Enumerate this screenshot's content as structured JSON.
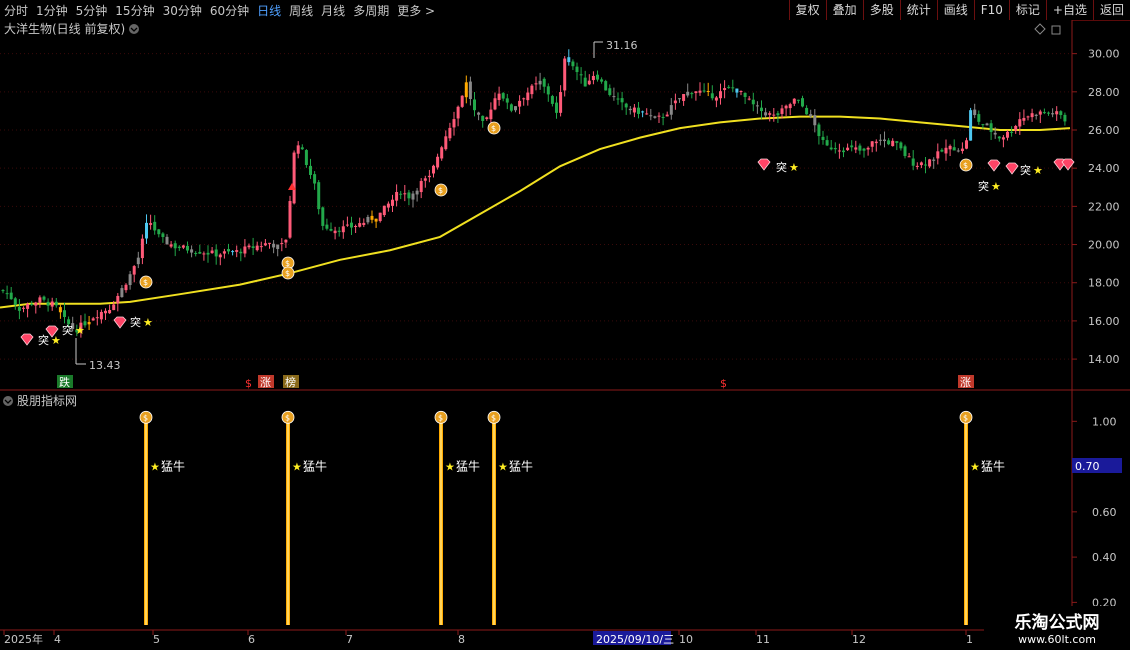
{
  "toolbar": {
    "periods": [
      "分时",
      "1分钟",
      "5分钟",
      "15分钟",
      "30分钟",
      "60分钟",
      "日线",
      "周线",
      "月线",
      "多周期",
      "更多 >"
    ],
    "active_period": "日线",
    "buttons": [
      "复权",
      "叠加",
      "多股",
      "统计",
      "画线",
      "F10",
      "标记",
      "+自选",
      "返回"
    ]
  },
  "colors": {
    "background": "#000000",
    "grid": "#3a0a0a",
    "axis": "#8b1a1a",
    "up": "#ff5a78",
    "down": "#22a84a",
    "ma": "#f0e020",
    "signal": "#ffaa00",
    "label": "#ffdd55",
    "active": "#4fa0ff"
  },
  "main_chart": {
    "title": "大洋生物(日线 前复权)",
    "y_ticks": [
      "30.00",
      "28.00",
      "26.00",
      "24.00",
      "22.00",
      "20.00",
      "18.00",
      "16.00",
      "14.00"
    ],
    "high_label": "31.16",
    "low_label": "13.43",
    "high_value": 31.16,
    "low_value": 13.43,
    "signal_tag": "突",
    "event_tags": [
      "跌",
      "涨",
      "榜",
      "涨"
    ]
  },
  "indicator": {
    "title": "股朋指标网",
    "y_ticks": [
      "1.00",
      "0.80",
      "0.60",
      "0.40",
      "0.20"
    ],
    "current_value": "0.70",
    "signal_label": "猛牛"
  },
  "x_axis": {
    "labels": [
      "2025年",
      "4",
      "5",
      "6",
      "7",
      "8",
      "2025/09/10/三",
      "10",
      "11",
      "12",
      "1"
    ]
  },
  "watermark": {
    "name": "乐淘公式网",
    "url": "www.60lt.com"
  },
  "chart_data": {
    "type": "candlestick",
    "ylim": [
      12.8,
      31.5
    ],
    "moving_average": [
      [
        0,
        16.7
      ],
      [
        30,
        16.9
      ],
      [
        60,
        16.9
      ],
      [
        100,
        16.9
      ],
      [
        130,
        17.0
      ],
      [
        180,
        17.4
      ],
      [
        240,
        17.9
      ],
      [
        290,
        18.5
      ],
      [
        340,
        19.2
      ],
      [
        390,
        19.7
      ],
      [
        440,
        20.4
      ],
      [
        480,
        21.6
      ],
      [
        520,
        22.8
      ],
      [
        560,
        24.1
      ],
      [
        600,
        25.0
      ],
      [
        640,
        25.6
      ],
      [
        680,
        26.1
      ],
      [
        720,
        26.4
      ],
      [
        760,
        26.6
      ],
      [
        800,
        26.7
      ],
      [
        840,
        26.7
      ],
      [
        880,
        26.6
      ],
      [
        920,
        26.4
      ],
      [
        960,
        26.2
      ],
      [
        1000,
        26.0
      ],
      [
        1040,
        26.0
      ],
      [
        1070,
        26.1
      ]
    ],
    "price_path": [
      [
        2,
        17.6
      ],
      [
        10,
        17.3
      ],
      [
        20,
        16.6
      ],
      [
        30,
        16.9
      ],
      [
        40,
        17.1
      ],
      [
        55,
        16.8
      ],
      [
        65,
        16.0
      ],
      [
        75,
        15.5
      ],
      [
        85,
        15.9
      ],
      [
        95,
        16.3
      ],
      [
        110,
        16.7
      ],
      [
        120,
        17.5
      ],
      [
        130,
        18.4
      ],
      [
        140,
        19.5
      ],
      [
        145,
        20.9
      ],
      [
        150,
        21.2
      ],
      [
        160,
        20.3
      ],
      [
        175,
        19.9
      ],
      [
        195,
        19.7
      ],
      [
        215,
        19.5
      ],
      [
        235,
        19.6
      ],
      [
        255,
        19.9
      ],
      [
        270,
        20.1
      ],
      [
        280,
        19.8
      ],
      [
        288,
        20.5
      ],
      [
        292,
        24.2
      ],
      [
        297,
        25.5
      ],
      [
        305,
        24.5
      ],
      [
        315,
        23.0
      ],
      [
        322,
        21.0
      ],
      [
        335,
        20.8
      ],
      [
        350,
        20.9
      ],
      [
        365,
        21.2
      ],
      [
        380,
        21.6
      ],
      [
        390,
        22.2
      ],
      [
        400,
        22.8
      ],
      [
        410,
        22.5
      ],
      [
        420,
        23.2
      ],
      [
        430,
        23.5
      ],
      [
        440,
        25.0
      ],
      [
        448,
        26.0
      ],
      [
        458,
        27.2
      ],
      [
        466,
        28.5
      ],
      [
        474,
        27.0
      ],
      [
        484,
        26.2
      ],
      [
        493,
        27.5
      ],
      [
        500,
        28.1
      ],
      [
        510,
        27.0
      ],
      [
        520,
        27.6
      ],
      [
        530,
        28.1
      ],
      [
        540,
        28.5
      ],
      [
        550,
        27.8
      ],
      [
        558,
        26.6
      ],
      [
        565,
        30.0
      ],
      [
        575,
        29.2
      ],
      [
        585,
        28.4
      ],
      [
        595,
        29.0
      ],
      [
        605,
        28.2
      ],
      [
        615,
        27.6
      ],
      [
        625,
        27.2
      ],
      [
        635,
        27.0
      ],
      [
        645,
        26.9
      ],
      [
        655,
        26.5
      ],
      [
        665,
        26.8
      ],
      [
        675,
        27.4
      ],
      [
        685,
        27.9
      ],
      [
        695,
        28.1
      ],
      [
        705,
        27.9
      ],
      [
        715,
        27.8
      ],
      [
        725,
        28.1
      ],
      [
        735,
        28.2
      ],
      [
        745,
        27.7
      ],
      [
        755,
        27.2
      ],
      [
        765,
        26.9
      ],
      [
        775,
        26.7
      ],
      [
        785,
        27.1
      ],
      [
        795,
        27.6
      ],
      [
        805,
        27.1
      ],
      [
        815,
        26.2
      ],
      [
        825,
        25.1
      ],
      [
        835,
        25.1
      ],
      [
        845,
        25.0
      ],
      [
        855,
        25.0
      ],
      [
        865,
        24.8
      ],
      [
        875,
        25.5
      ],
      [
        885,
        25.4
      ],
      [
        895,
        25.3
      ],
      [
        905,
        24.7
      ],
      [
        915,
        24.2
      ],
      [
        925,
        24.3
      ],
      [
        935,
        24.6
      ],
      [
        945,
        25.0
      ],
      [
        955,
        25.1
      ],
      [
        965,
        24.9
      ],
      [
        970,
        27.0
      ],
      [
        980,
        26.4
      ],
      [
        990,
        26.0
      ],
      [
        1000,
        25.6
      ],
      [
        1010,
        25.9
      ],
      [
        1020,
        26.6
      ],
      [
        1030,
        26.8
      ],
      [
        1040,
        26.9
      ],
      [
        1050,
        26.9
      ],
      [
        1060,
        26.8
      ],
      [
        1068,
        26.3
      ]
    ],
    "indicator_signals_x": [
      146,
      288,
      441,
      494,
      966
    ]
  }
}
